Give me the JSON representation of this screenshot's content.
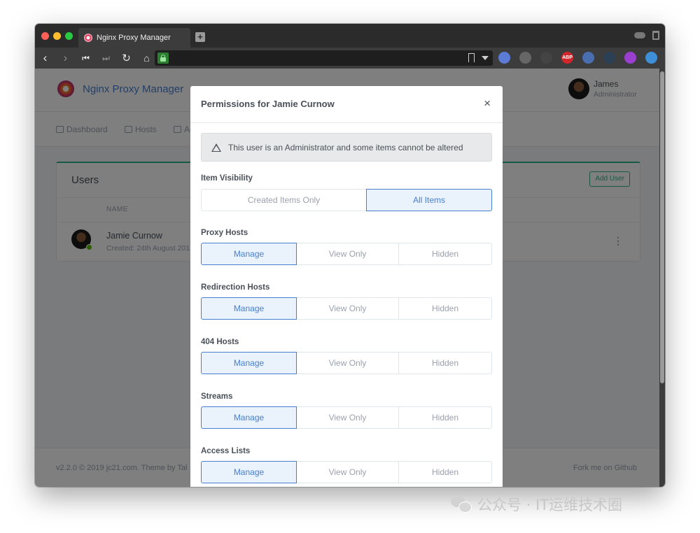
{
  "browser": {
    "tab_title": "Nginx Proxy Manager",
    "new_tab_label": "+",
    "extensions": [
      {
        "name": "atom-ext-icon",
        "label": "",
        "color": "#5b7bd5"
      },
      {
        "name": "ghostery-icon",
        "label": "",
        "color": "#666666"
      },
      {
        "name": "gimp-icon",
        "label": "",
        "color": "#444444"
      },
      {
        "name": "adblock-plus-icon",
        "label": "ABP",
        "color": "#d2262b"
      },
      {
        "name": "pen-icon",
        "label": "",
        "color": "#4a6fb0"
      },
      {
        "name": "react-devtools-icon",
        "label": "",
        "color": "#2b3f55"
      },
      {
        "name": "octo-ext-icon",
        "label": "",
        "color": "#9b3fd1"
      },
      {
        "name": "lighthouse-icon",
        "label": "",
        "color": "#3f8fd8"
      }
    ]
  },
  "app": {
    "brand": "Nginx Proxy Manager",
    "user": {
      "name": "James",
      "role": "Administrator"
    },
    "nav": [
      "Dashboard",
      "Hosts",
      "Ac"
    ],
    "users_card": {
      "title": "Users",
      "add_button": "Add User",
      "column_name": "NAME",
      "row": {
        "name": "Jamie Curnow",
        "created": "Created: 24th August 201"
      }
    },
    "footer": {
      "left": "v2.2.0 © 2019 jc21.com. Theme by Tal",
      "right": "Fork me on Github"
    }
  },
  "modal": {
    "title": "Permissions for Jamie Curnow",
    "close": "×",
    "alert": "This user is an Administrator and some items cannot be altered",
    "visibility": {
      "label": "Item Visibility",
      "options": [
        "Created Items Only",
        "All Items"
      ],
      "selected": "All Items"
    },
    "permissions": [
      {
        "label": "Proxy Hosts",
        "options": [
          "Manage",
          "View Only",
          "Hidden"
        ],
        "selected": "Manage"
      },
      {
        "label": "Redirection Hosts",
        "options": [
          "Manage",
          "View Only",
          "Hidden"
        ],
        "selected": "Manage"
      },
      {
        "label": "404 Hosts",
        "options": [
          "Manage",
          "View Only",
          "Hidden"
        ],
        "selected": "Manage"
      },
      {
        "label": "Streams",
        "options": [
          "Manage",
          "View Only",
          "Hidden"
        ],
        "selected": "Manage"
      },
      {
        "label": "Access Lists",
        "options": [
          "Manage",
          "View Only",
          "Hidden"
        ],
        "selected": "Manage"
      }
    ]
  },
  "watermark": "公众号 · IT运维技术圈"
}
